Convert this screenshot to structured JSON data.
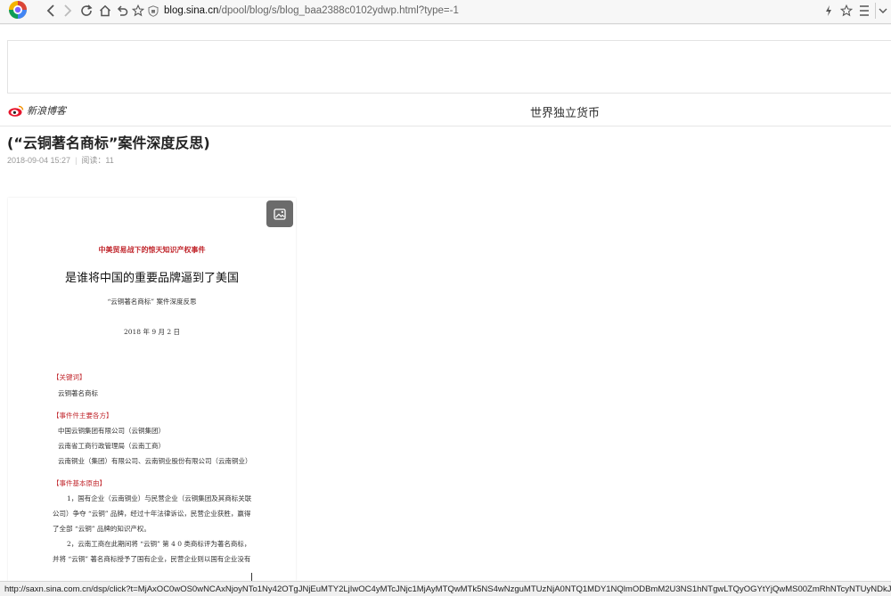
{
  "browser": {
    "url_host": "blog.sina.cn",
    "url_path": "/dpool/blog/s/blog_baa2388c0102ydwp.html?type=-1",
    "status_url": "http://saxn.sina.com.cn/dsp/click?t=MjAxOC0wOS0wNCAxNjoyNTo1Ny42OTgJNjEuMTY2LjIwOC4yMTcJNjc1MjAyMTQwMTk5NS4wNzguMTUzNjA0NTQ1MDY1NQlmODBmM2U3NS1hNTgwLTQyOGYtYjQwMS00ZmRhNTcyNTUyNDkJMzM0MzgzNwk2NDk0MTI0"
  },
  "blog": {
    "logo_text": "新浪博客",
    "blog_name": "世界独立货币"
  },
  "article": {
    "title": "(“云铜著名商标”案件深度反思)",
    "date": "2018-09-04 15:27",
    "reads": "阅读：11"
  },
  "document": {
    "subtitle": "中美贸易战下的惊天知识产权事件",
    "title": "是谁将中国的重要品牌逼到了美国",
    "case_title": "“云铜著名商标” 案件深度反思",
    "date": "2018 年 9 月 2 日",
    "keywords_heading": "【关键词】",
    "keywords": "云铜著名商标",
    "parties_heading": "【事件件主要各方】",
    "parties": [
      "中国云铜集团有限公司（云铜集团）",
      "云南省工商行政管理局（云南工商）",
      "云南铜业（集团）有限公司、云南铜业股份有限公司（云南铜业）"
    ],
    "facts_heading": "【事件基本原由】",
    "facts": [
      "1，国有企业（云南铜业）与民营企业（云铜集团及其商标关联",
      "公司）争夺 “云铜” 品牌，经过十年法律诉讼，民营企业获胜，赢得",
      "了全部 “云铜” 品牌的知识产权。",
      "2，云南工商在此期间将 “云铜” 第 4 0 类商标评为著名商标，",
      "并将 “云铜” 著名商标授予了国有企业，民营企业则以国有企业没有"
    ]
  }
}
